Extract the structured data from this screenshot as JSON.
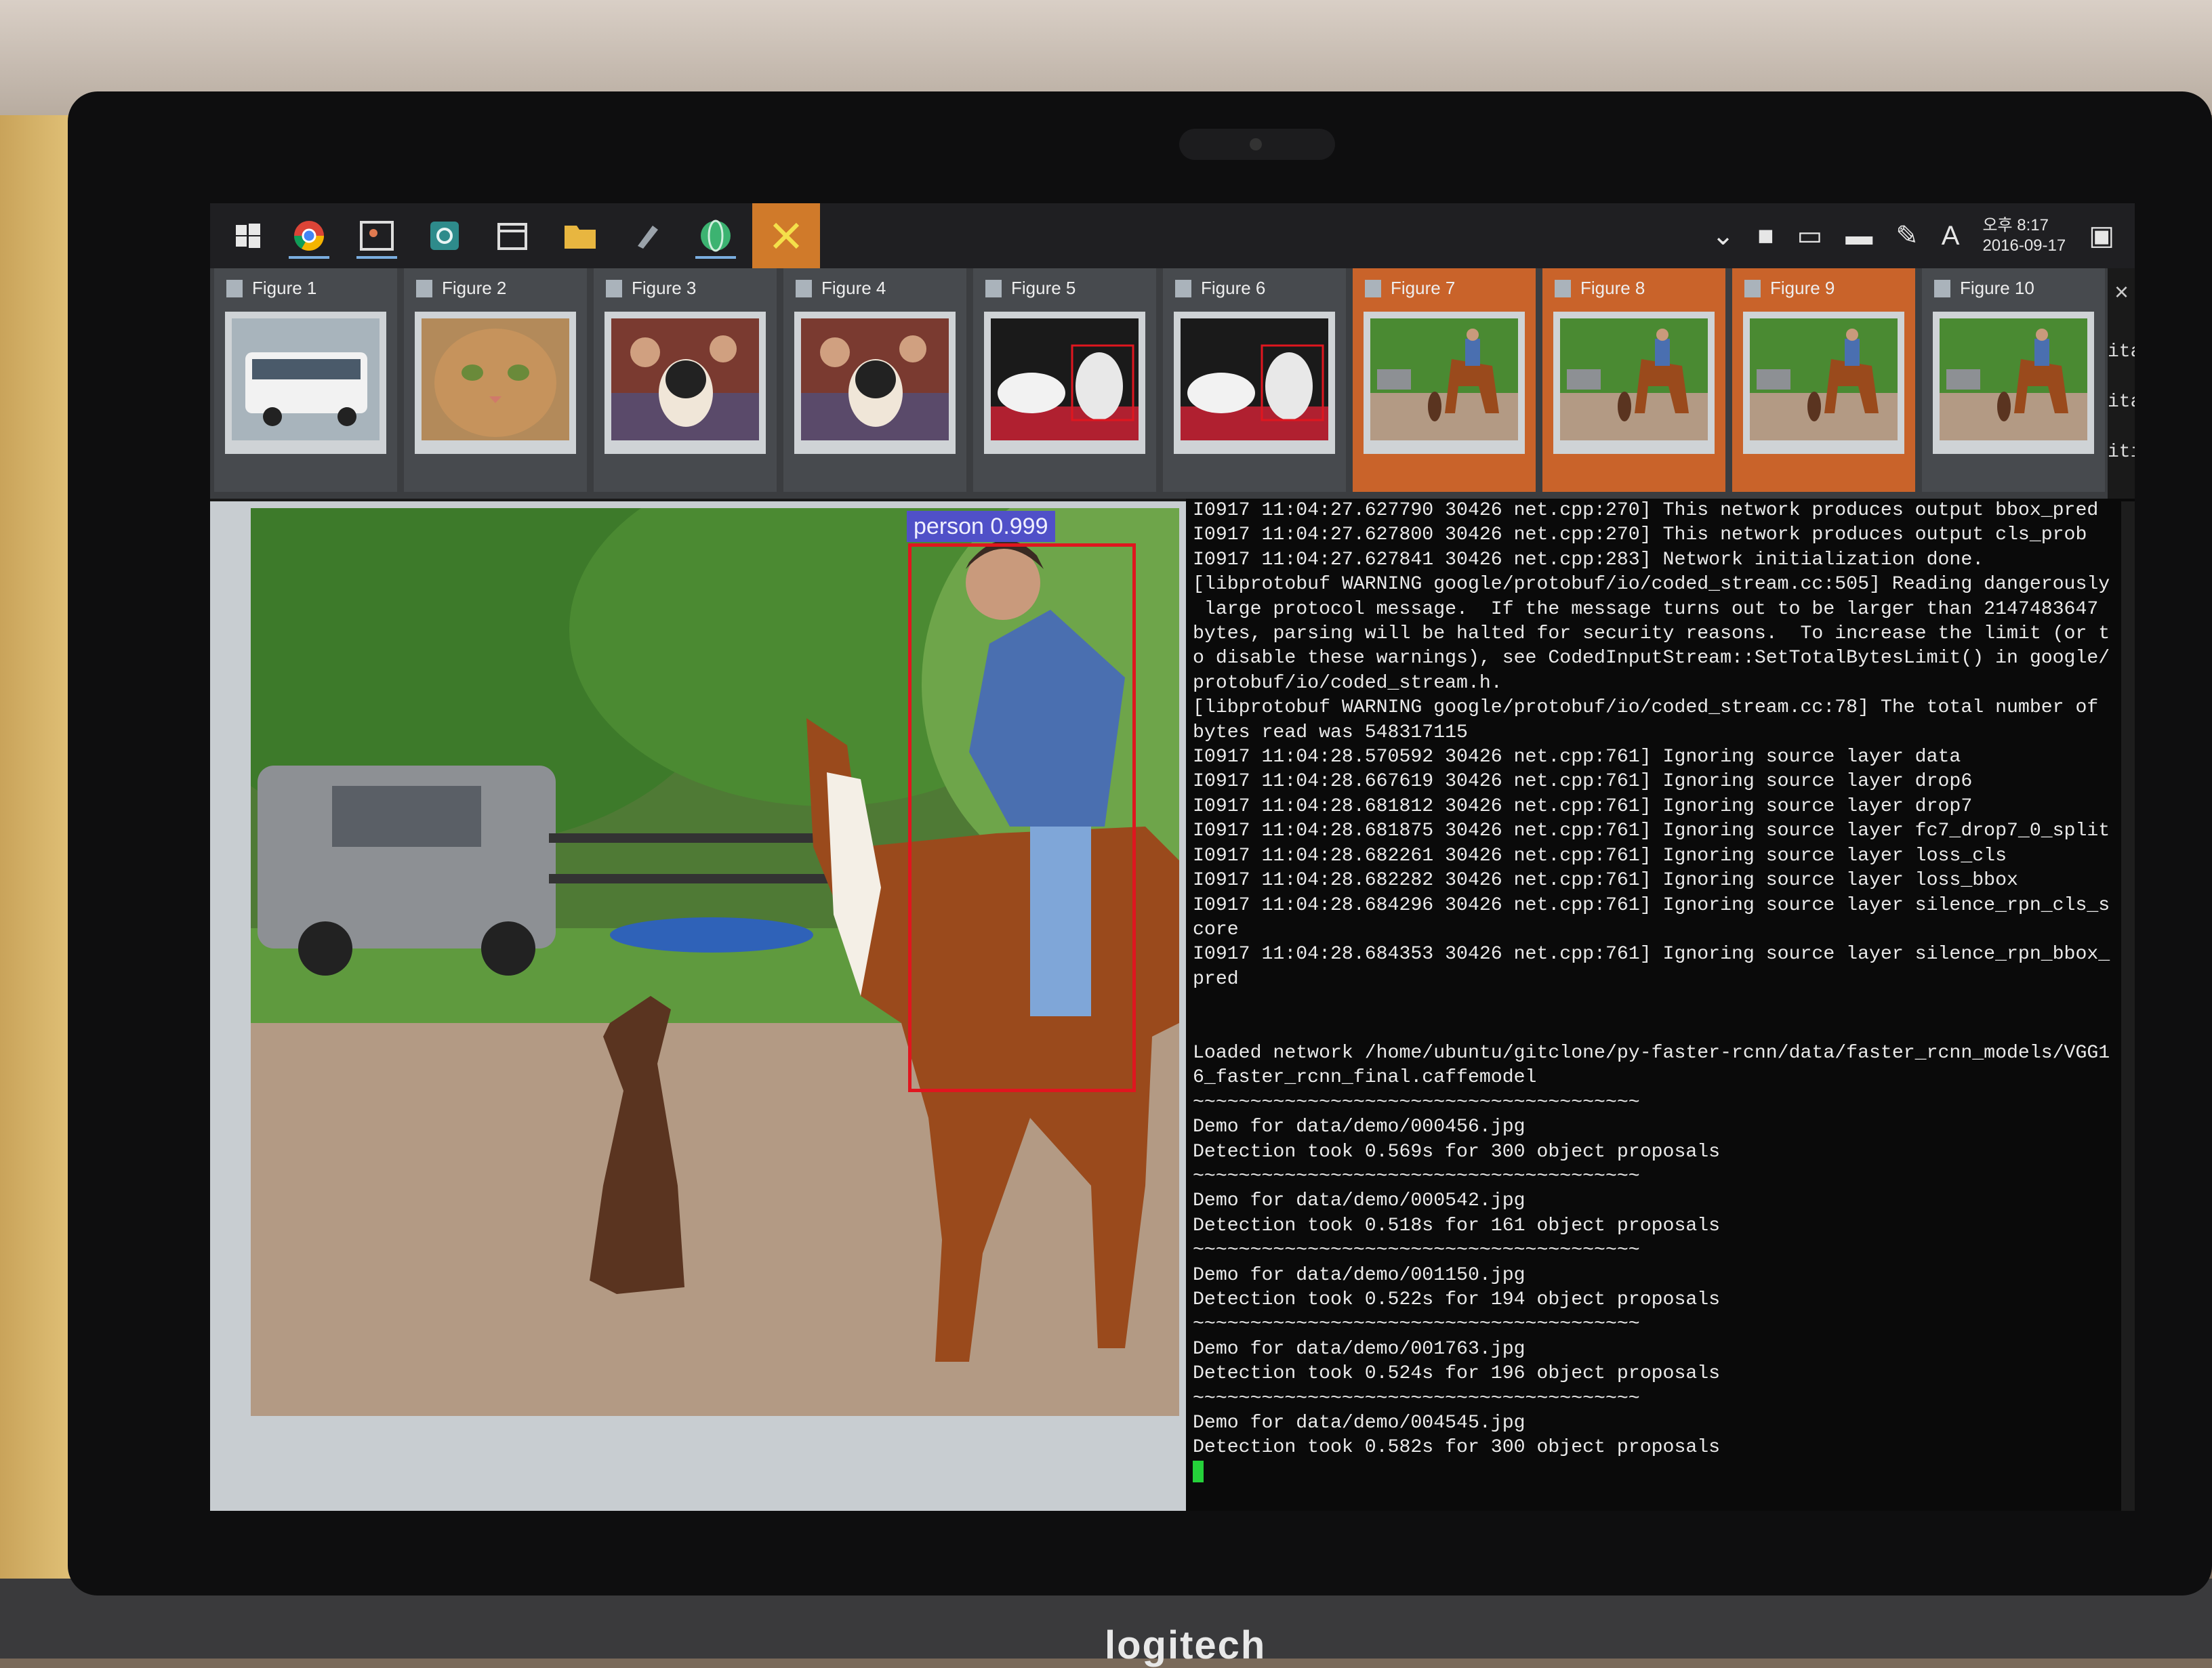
{
  "brand": "logitech",
  "taskbar": {
    "icons": [
      "windows-icon",
      "chrome-icon",
      "photos-icon",
      "settings-icon",
      "calendar-icon",
      "folder-icon",
      "pen-icon",
      "globe-icon",
      "xming-icon"
    ],
    "tray": {
      "clock_time": "오후 8:17",
      "clock_date": "2016-09-17",
      "ime": "A"
    }
  },
  "figures": [
    {
      "label": "Figure 1",
      "highlighted": false,
      "scene": "bus"
    },
    {
      "label": "Figure 2",
      "highlighted": false,
      "scene": "cat"
    },
    {
      "label": "Figure 3",
      "highlighted": false,
      "scene": "dog-couch"
    },
    {
      "label": "Figure 4",
      "highlighted": false,
      "scene": "dog-couch"
    },
    {
      "label": "Figure 5",
      "highlighted": false,
      "scene": "cats"
    },
    {
      "label": "Figure 6",
      "highlighted": false,
      "scene": "cats"
    },
    {
      "label": "Figure 7",
      "highlighted": true,
      "scene": "horse"
    },
    {
      "label": "Figure 8",
      "highlighted": true,
      "scene": "horse"
    },
    {
      "label": "Figure 9",
      "highlighted": true,
      "scene": "horse"
    },
    {
      "label": "Figure 10",
      "highlighted": false,
      "scene": "horse"
    }
  ],
  "side_fragments": [
    "itat",
    "itat",
    "itio"
  ],
  "detection": {
    "label": "person 0.999",
    "box_color": "#e0161f"
  },
  "terminal": {
    "lines": [
      "I0917 11:04:27.627790 30426 net.cpp:270] This network produces output bbox_pred",
      "I0917 11:04:27.627800 30426 net.cpp:270] This network produces output cls_prob",
      "I0917 11:04:27.627841 30426 net.cpp:283] Network initialization done.",
      "[libprotobuf WARNING google/protobuf/io/coded_stream.cc:505] Reading dangerously",
      " large protocol message.  If the message turns out to be larger than 2147483647",
      "bytes, parsing will be halted for security reasons.  To increase the limit (or t",
      "o disable these warnings), see CodedInputStream::SetTotalBytesLimit() in google/",
      "protobuf/io/coded_stream.h.",
      "[libprotobuf WARNING google/protobuf/io/coded_stream.cc:78] The total number of",
      "bytes read was 548317115",
      "I0917 11:04:28.570592 30426 net.cpp:761] Ignoring source layer data",
      "I0917 11:04:28.667619 30426 net.cpp:761] Ignoring source layer drop6",
      "I0917 11:04:28.681812 30426 net.cpp:761] Ignoring source layer drop7",
      "I0917 11:04:28.681875 30426 net.cpp:761] Ignoring source layer fc7_drop7_0_split",
      "I0917 11:04:28.682261 30426 net.cpp:761] Ignoring source layer loss_cls",
      "I0917 11:04:28.682282 30426 net.cpp:761] Ignoring source layer loss_bbox",
      "I0917 11:04:28.684296 30426 net.cpp:761] Ignoring source layer silence_rpn_cls_s",
      "core",
      "I0917 11:04:28.684353 30426 net.cpp:761] Ignoring source layer silence_rpn_bbox_",
      "pred",
      "",
      "",
      "Loaded network /home/ubuntu/gitclone/py-faster-rcnn/data/faster_rcnn_models/VGG1",
      "6_faster_rcnn_final.caffemodel",
      "~~~~~~~~~~~~~~~~~~~~~~~~~~~~~~~~~~~~~~~",
      "Demo for data/demo/000456.jpg",
      "Detection took 0.569s for 300 object proposals",
      "~~~~~~~~~~~~~~~~~~~~~~~~~~~~~~~~~~~~~~~",
      "Demo for data/demo/000542.jpg",
      "Detection took 0.518s for 161 object proposals",
      "~~~~~~~~~~~~~~~~~~~~~~~~~~~~~~~~~~~~~~~",
      "Demo for data/demo/001150.jpg",
      "Detection took 0.522s for 194 object proposals",
      "~~~~~~~~~~~~~~~~~~~~~~~~~~~~~~~~~~~~~~~",
      "Demo for data/demo/001763.jpg",
      "Detection took 0.524s for 196 object proposals",
      "~~~~~~~~~~~~~~~~~~~~~~~~~~~~~~~~~~~~~~~",
      "Demo for data/demo/004545.jpg",
      "Detection took 0.582s for 300 object proposals"
    ]
  }
}
